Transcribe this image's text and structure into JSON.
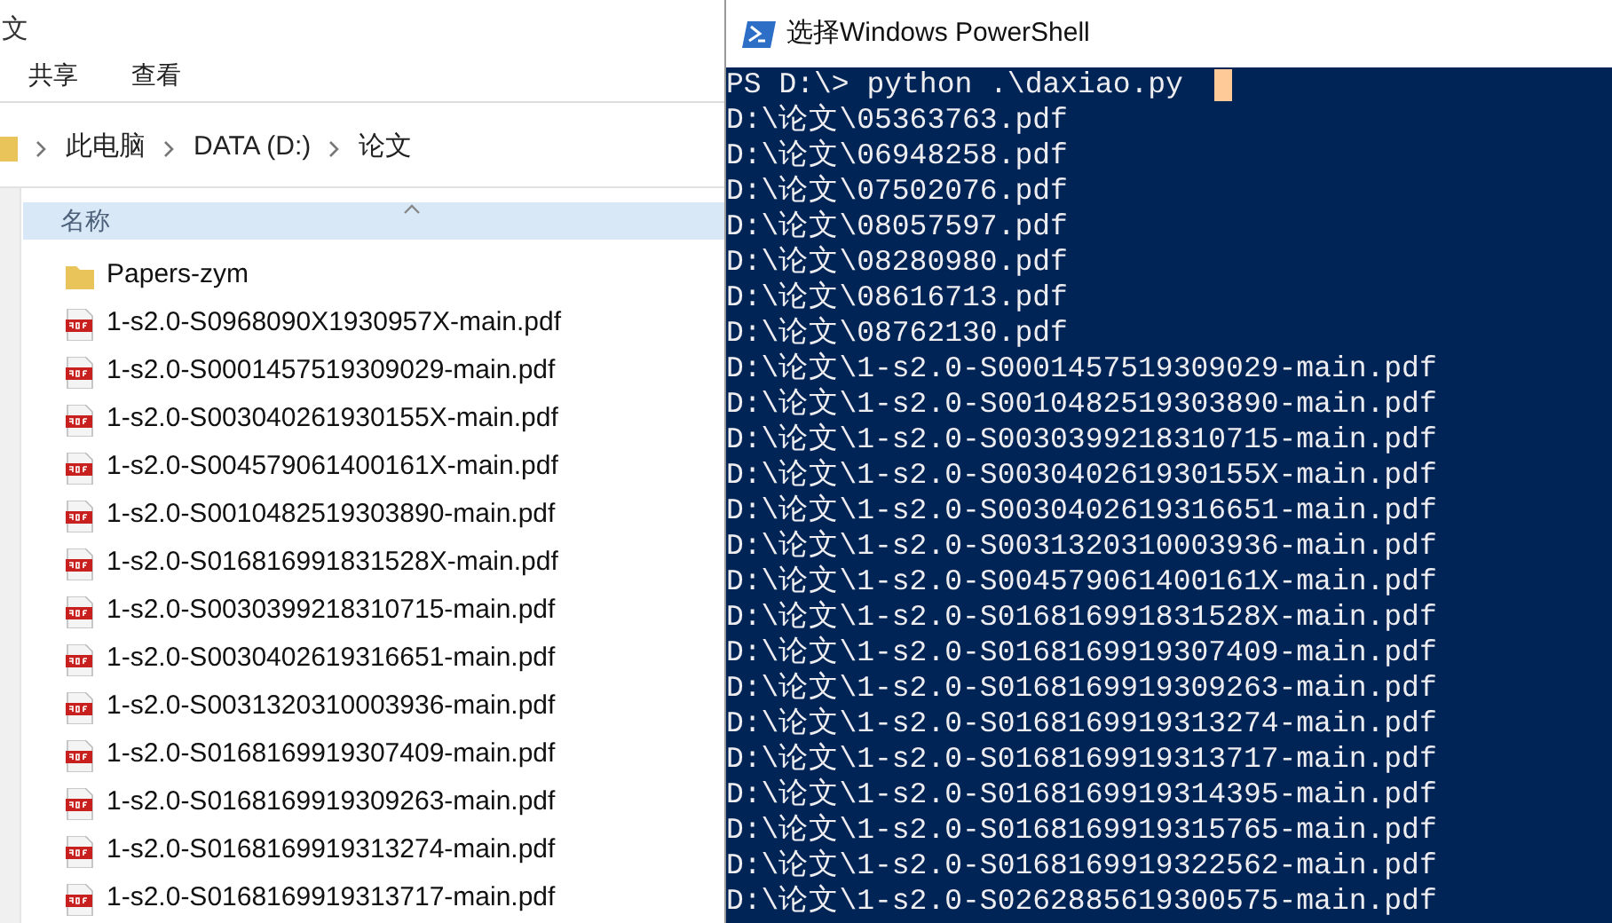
{
  "explorer": {
    "title": "文",
    "ribbon_tabs": [
      "共享",
      "查看"
    ],
    "breadcrumb": [
      "此电脑",
      "DATA (D:)",
      "论文"
    ],
    "column_header": "名称",
    "files": [
      {
        "kind": "folder",
        "name": "Papers-zym"
      },
      {
        "kind": "pdf",
        "name": "1-s2.0-S0968090X1930957X-main.pdf"
      },
      {
        "kind": "pdf",
        "name": "1-s2.0-S0001457519309029-main.pdf"
      },
      {
        "kind": "pdf",
        "name": "1-s2.0-S003040261930155X-main.pdf"
      },
      {
        "kind": "pdf",
        "name": "1-s2.0-S004579061400161X-main.pdf"
      },
      {
        "kind": "pdf",
        "name": "1-s2.0-S0010482519303890-main.pdf"
      },
      {
        "kind": "pdf",
        "name": "1-s2.0-S016816991831528X-main.pdf"
      },
      {
        "kind": "pdf",
        "name": "1-s2.0-S0030399218310715-main.pdf"
      },
      {
        "kind": "pdf",
        "name": "1-s2.0-S0030402619316651-main.pdf"
      },
      {
        "kind": "pdf",
        "name": "1-s2.0-S0031320310003936-main.pdf"
      },
      {
        "kind": "pdf",
        "name": "1-s2.0-S0168169919307409-main.pdf"
      },
      {
        "kind": "pdf",
        "name": "1-s2.0-S0168169919309263-main.pdf"
      },
      {
        "kind": "pdf",
        "name": "1-s2.0-S0168169919313274-main.pdf"
      },
      {
        "kind": "pdf",
        "name": "1-s2.0-S0168169919313717-main.pdf"
      }
    ]
  },
  "powershell": {
    "title": "选择Windows PowerShell",
    "prompt": "PS D:\\> python .\\daxiao.py",
    "output": [
      "D:\\论文\\05363763.pdf",
      "D:\\论文\\06948258.pdf",
      "D:\\论文\\07502076.pdf",
      "D:\\论文\\08057597.pdf",
      "D:\\论文\\08280980.pdf",
      "D:\\论文\\08616713.pdf",
      "D:\\论文\\08762130.pdf",
      "D:\\论文\\1-s2.0-S0001457519309029-main.pdf",
      "D:\\论文\\1-s2.0-S0010482519303890-main.pdf",
      "D:\\论文\\1-s2.0-S0030399218310715-main.pdf",
      "D:\\论文\\1-s2.0-S003040261930155X-main.pdf",
      "D:\\论文\\1-s2.0-S0030402619316651-main.pdf",
      "D:\\论文\\1-s2.0-S0031320310003936-main.pdf",
      "D:\\论文\\1-s2.0-S004579061400161X-main.pdf",
      "D:\\论文\\1-s2.0-S016816991831528X-main.pdf",
      "D:\\论文\\1-s2.0-S0168169919307409-main.pdf",
      "D:\\论文\\1-s2.0-S0168169919309263-main.pdf",
      "D:\\论文\\1-s2.0-S0168169919313274-main.pdf",
      "D:\\论文\\1-s2.0-S0168169919313717-main.pdf",
      "D:\\论文\\1-s2.0-S0168169919314395-main.pdf",
      "D:\\论文\\1-s2.0-S0168169919315765-main.pdf",
      "D:\\论文\\1-s2.0-S0168169919322562-main.pdf",
      "D:\\论文\\1-s2.0-S0262885619300575-main.pdf"
    ]
  }
}
